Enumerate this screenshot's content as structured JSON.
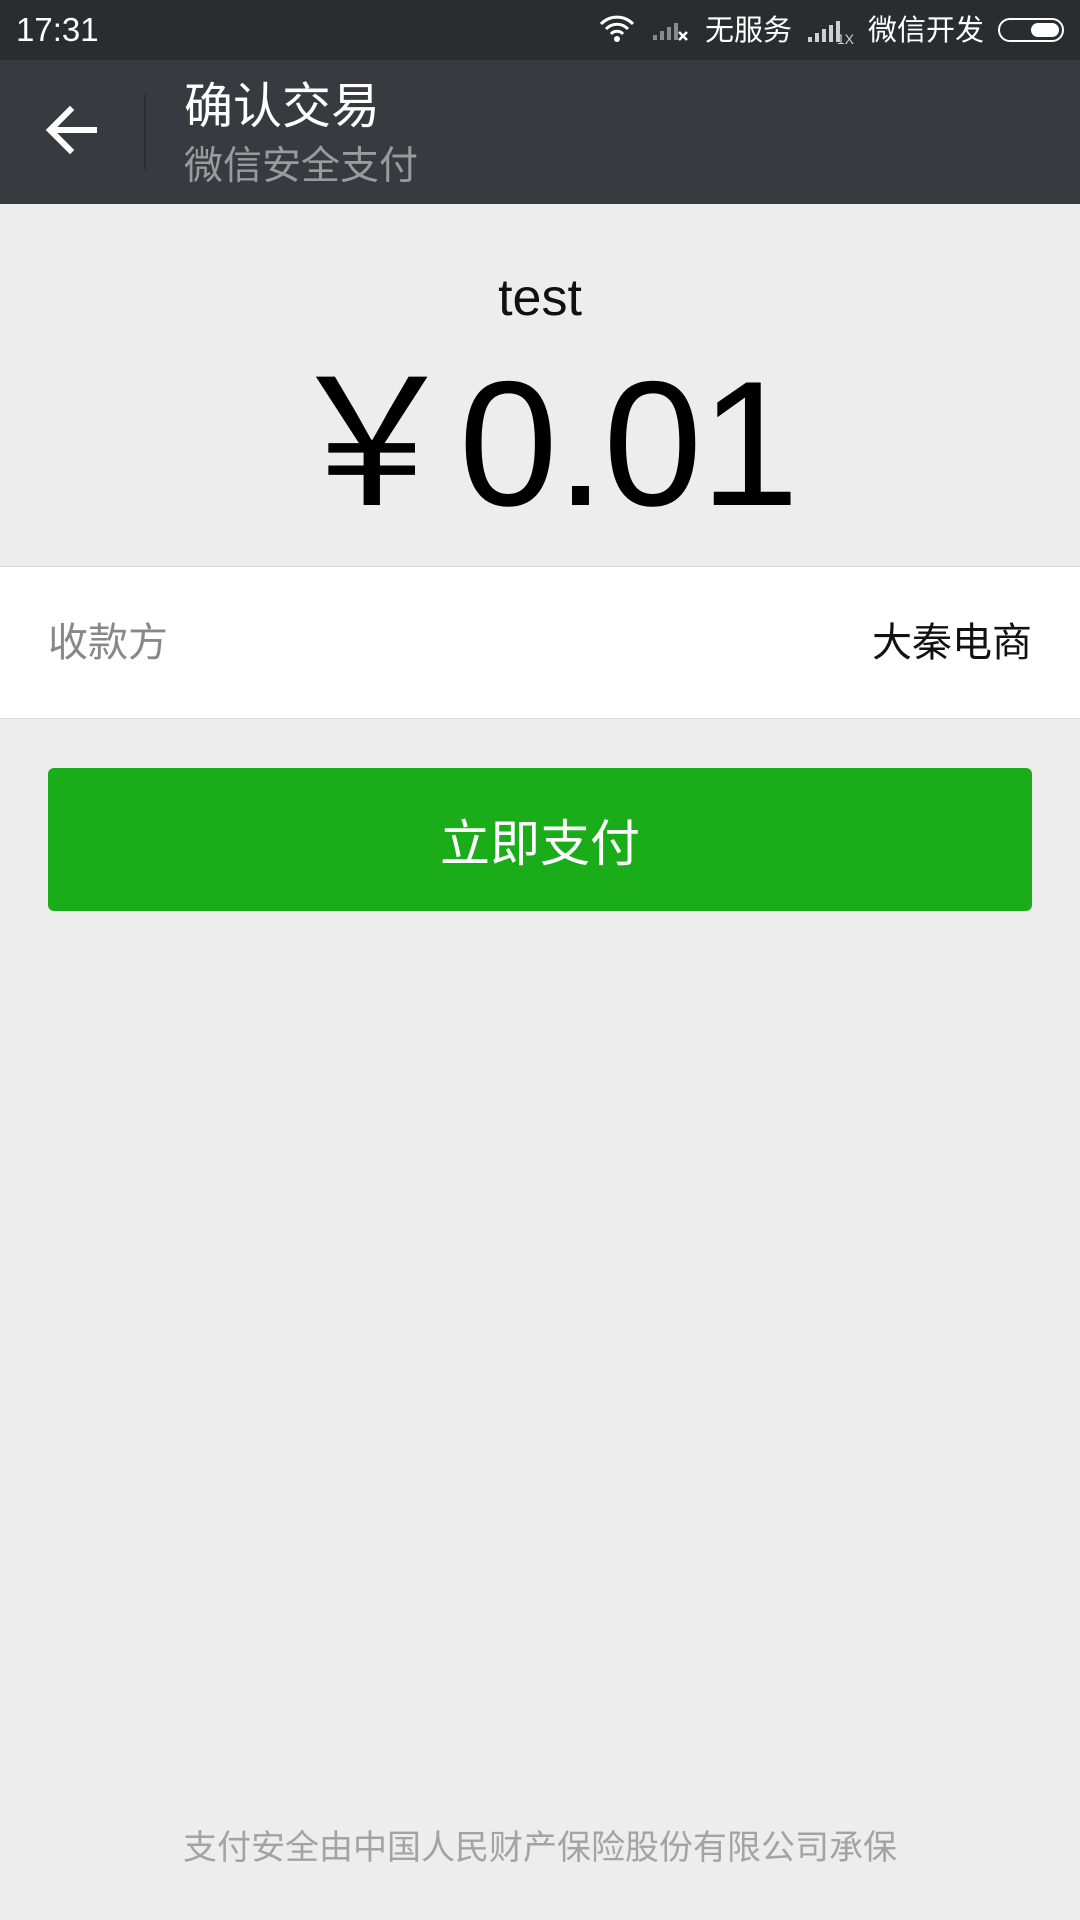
{
  "status_bar": {
    "time": "17:31",
    "no_service": "无服务",
    "network_speed": "1X",
    "carrier": "微信开发",
    "icons": [
      "wifi-icon",
      "signal-x-icon",
      "signal-icon",
      "battery-icon"
    ]
  },
  "header": {
    "back_icon": "arrow-left-icon",
    "title": "确认交易",
    "subtitle": "微信安全支付"
  },
  "payment": {
    "product_name": "test",
    "amount": "￥0.01",
    "payee_label": "收款方",
    "payee_value": "大秦电商"
  },
  "actions": {
    "pay_now": "立即支付"
  },
  "footer": {
    "insurance_note": "支付安全由中国人民财产保险股份有限公司承保"
  },
  "colors": {
    "status_bar_bg": "#2b2c30",
    "header_bg": "#393a3f",
    "page_bg": "#ededed",
    "pay_button": "#1aad19"
  }
}
